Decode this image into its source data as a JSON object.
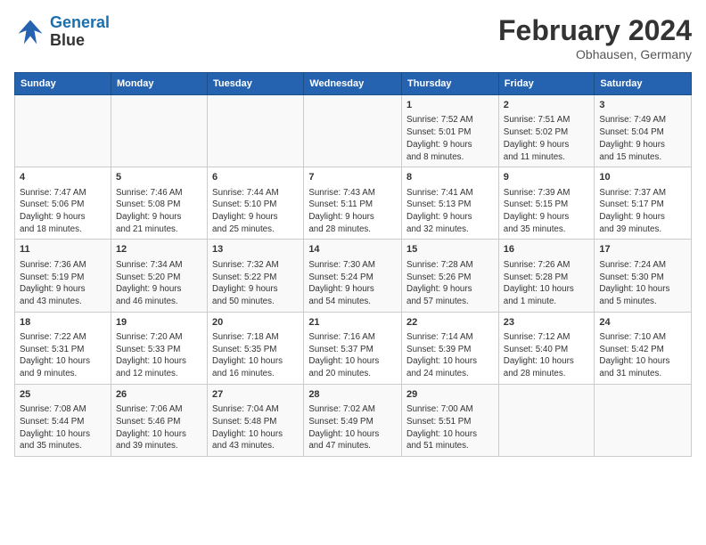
{
  "header": {
    "logo_line1": "General",
    "logo_line2": "Blue",
    "month": "February 2024",
    "location": "Obhausen, Germany"
  },
  "weekdays": [
    "Sunday",
    "Monday",
    "Tuesday",
    "Wednesday",
    "Thursday",
    "Friday",
    "Saturday"
  ],
  "weeks": [
    [
      {
        "day": "",
        "info": ""
      },
      {
        "day": "",
        "info": ""
      },
      {
        "day": "",
        "info": ""
      },
      {
        "day": "",
        "info": ""
      },
      {
        "day": "1",
        "info": "Sunrise: 7:52 AM\nSunset: 5:01 PM\nDaylight: 9 hours\nand 8 minutes."
      },
      {
        "day": "2",
        "info": "Sunrise: 7:51 AM\nSunset: 5:02 PM\nDaylight: 9 hours\nand 11 minutes."
      },
      {
        "day": "3",
        "info": "Sunrise: 7:49 AM\nSunset: 5:04 PM\nDaylight: 9 hours\nand 15 minutes."
      }
    ],
    [
      {
        "day": "4",
        "info": "Sunrise: 7:47 AM\nSunset: 5:06 PM\nDaylight: 9 hours\nand 18 minutes."
      },
      {
        "day": "5",
        "info": "Sunrise: 7:46 AM\nSunset: 5:08 PM\nDaylight: 9 hours\nand 21 minutes."
      },
      {
        "day": "6",
        "info": "Sunrise: 7:44 AM\nSunset: 5:10 PM\nDaylight: 9 hours\nand 25 minutes."
      },
      {
        "day": "7",
        "info": "Sunrise: 7:43 AM\nSunset: 5:11 PM\nDaylight: 9 hours\nand 28 minutes."
      },
      {
        "day": "8",
        "info": "Sunrise: 7:41 AM\nSunset: 5:13 PM\nDaylight: 9 hours\nand 32 minutes."
      },
      {
        "day": "9",
        "info": "Sunrise: 7:39 AM\nSunset: 5:15 PM\nDaylight: 9 hours\nand 35 minutes."
      },
      {
        "day": "10",
        "info": "Sunrise: 7:37 AM\nSunset: 5:17 PM\nDaylight: 9 hours\nand 39 minutes."
      }
    ],
    [
      {
        "day": "11",
        "info": "Sunrise: 7:36 AM\nSunset: 5:19 PM\nDaylight: 9 hours\nand 43 minutes."
      },
      {
        "day": "12",
        "info": "Sunrise: 7:34 AM\nSunset: 5:20 PM\nDaylight: 9 hours\nand 46 minutes."
      },
      {
        "day": "13",
        "info": "Sunrise: 7:32 AM\nSunset: 5:22 PM\nDaylight: 9 hours\nand 50 minutes."
      },
      {
        "day": "14",
        "info": "Sunrise: 7:30 AM\nSunset: 5:24 PM\nDaylight: 9 hours\nand 54 minutes."
      },
      {
        "day": "15",
        "info": "Sunrise: 7:28 AM\nSunset: 5:26 PM\nDaylight: 9 hours\nand 57 minutes."
      },
      {
        "day": "16",
        "info": "Sunrise: 7:26 AM\nSunset: 5:28 PM\nDaylight: 10 hours\nand 1 minute."
      },
      {
        "day": "17",
        "info": "Sunrise: 7:24 AM\nSunset: 5:30 PM\nDaylight: 10 hours\nand 5 minutes."
      }
    ],
    [
      {
        "day": "18",
        "info": "Sunrise: 7:22 AM\nSunset: 5:31 PM\nDaylight: 10 hours\nand 9 minutes."
      },
      {
        "day": "19",
        "info": "Sunrise: 7:20 AM\nSunset: 5:33 PM\nDaylight: 10 hours\nand 12 minutes."
      },
      {
        "day": "20",
        "info": "Sunrise: 7:18 AM\nSunset: 5:35 PM\nDaylight: 10 hours\nand 16 minutes."
      },
      {
        "day": "21",
        "info": "Sunrise: 7:16 AM\nSunset: 5:37 PM\nDaylight: 10 hours\nand 20 minutes."
      },
      {
        "day": "22",
        "info": "Sunrise: 7:14 AM\nSunset: 5:39 PM\nDaylight: 10 hours\nand 24 minutes."
      },
      {
        "day": "23",
        "info": "Sunrise: 7:12 AM\nSunset: 5:40 PM\nDaylight: 10 hours\nand 28 minutes."
      },
      {
        "day": "24",
        "info": "Sunrise: 7:10 AM\nSunset: 5:42 PM\nDaylight: 10 hours\nand 31 minutes."
      }
    ],
    [
      {
        "day": "25",
        "info": "Sunrise: 7:08 AM\nSunset: 5:44 PM\nDaylight: 10 hours\nand 35 minutes."
      },
      {
        "day": "26",
        "info": "Sunrise: 7:06 AM\nSunset: 5:46 PM\nDaylight: 10 hours\nand 39 minutes."
      },
      {
        "day": "27",
        "info": "Sunrise: 7:04 AM\nSunset: 5:48 PM\nDaylight: 10 hours\nand 43 minutes."
      },
      {
        "day": "28",
        "info": "Sunrise: 7:02 AM\nSunset: 5:49 PM\nDaylight: 10 hours\nand 47 minutes."
      },
      {
        "day": "29",
        "info": "Sunrise: 7:00 AM\nSunset: 5:51 PM\nDaylight: 10 hours\nand 51 minutes."
      },
      {
        "day": "",
        "info": ""
      },
      {
        "day": "",
        "info": ""
      }
    ]
  ]
}
